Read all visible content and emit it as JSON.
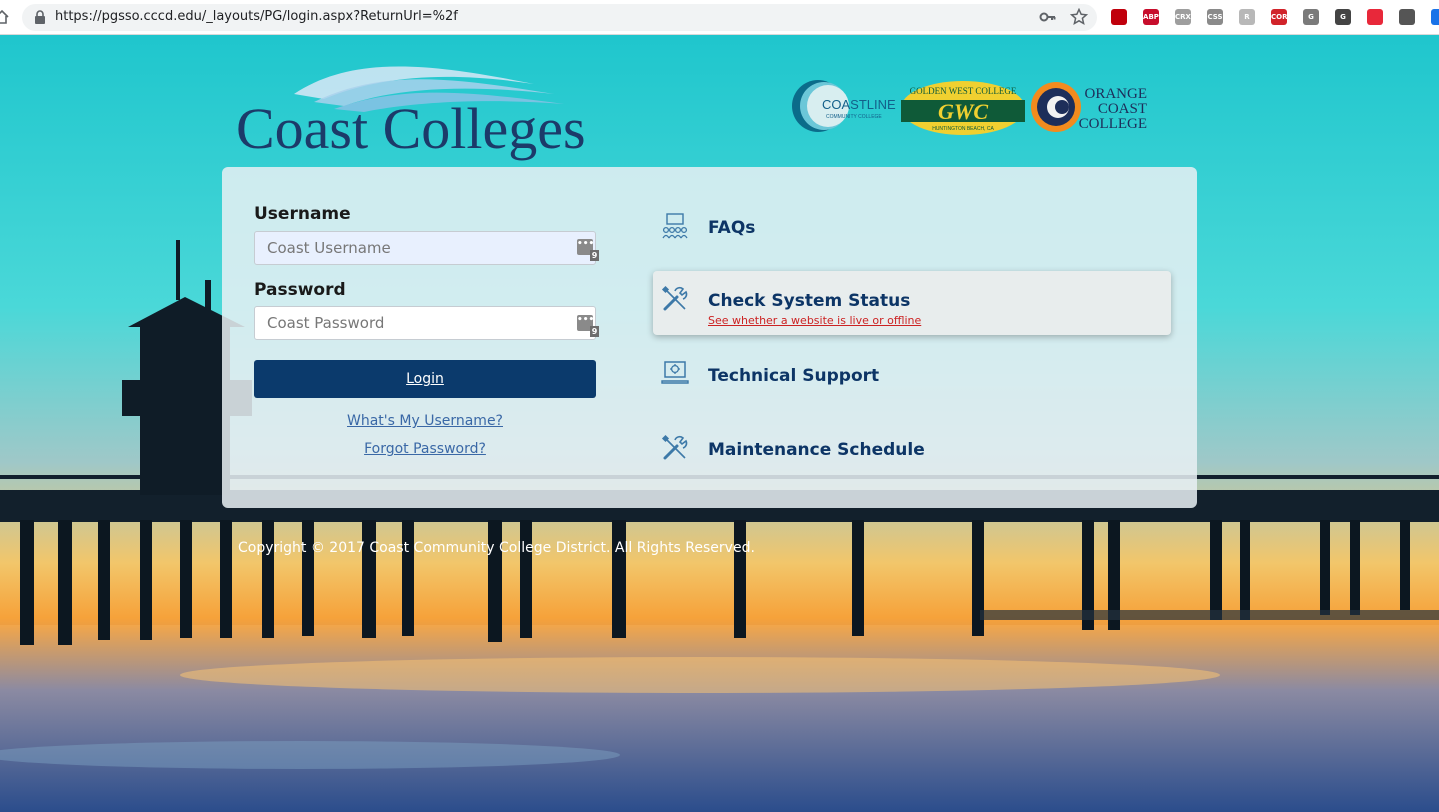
{
  "browser": {
    "url": "https://pgsso.cccd.edu/_layouts/PG/login.aspx?ReturnUrl=%2f",
    "extensions": [
      {
        "name": "ublock",
        "label": "",
        "color": "#c0000c"
      },
      {
        "name": "adblock-plus",
        "label": "ABP",
        "color": "#c70d2c"
      },
      {
        "name": "crx",
        "label": "CRX",
        "color": "#9e9e9e"
      },
      {
        "name": "css",
        "label": "CSS",
        "color": "#8a8a8a"
      },
      {
        "name": "r",
        "label": "R",
        "color": "#b8b8b8"
      },
      {
        "name": "cors",
        "label": "CORS",
        "color": "#d1232a"
      },
      {
        "name": "g-ext",
        "label": "G",
        "color": "#7a7a7a"
      },
      {
        "name": "grammarly",
        "label": "G",
        "color": "#444444"
      },
      {
        "name": "stack",
        "label": "",
        "color": "#e8283a"
      },
      {
        "name": "face",
        "label": "",
        "color": "#555555"
      },
      {
        "name": "blue-ext",
        "label": "",
        "color": "#1a73e8"
      }
    ]
  },
  "brand": {
    "main_logo": "Coast Colleges",
    "partner_logos": [
      "COASTLINE",
      "COMMUNITY COLLEGE",
      "GOLDEN WEST COLLEGE",
      "GWC",
      "HUNTINGTON BEACH, CA",
      "ORANGE",
      "COAST",
      "COLLEGE"
    ]
  },
  "login": {
    "username_label": "Username",
    "username_placeholder": "Coast Username",
    "password_label": "Password",
    "password_placeholder": "Coast Password",
    "manager_icon_text": "•••",
    "manager_badge": "9",
    "login_button": "Login",
    "forgot_username": "What's My Username?",
    "forgot_password": "Forgot Password?"
  },
  "menu": [
    {
      "title": "FAQs",
      "subtitle": "",
      "icon": "people-screen-icon"
    },
    {
      "title": "Check System Status",
      "subtitle": "See whether a website is live or offline",
      "icon": "tools-icon"
    },
    {
      "title": "Technical Support",
      "subtitle": "",
      "icon": "laptop-support-icon"
    },
    {
      "title": "Maintenance Schedule",
      "subtitle": "",
      "icon": "tools-icon"
    }
  ],
  "footer": {
    "copyright": "Copyright © 2017 Coast Community College District. All Rights Reserved."
  },
  "colors": {
    "primary": "#0b3a6c",
    "link": "#3a68a6",
    "alert": "#cc2222",
    "sky": "#2ad0d4"
  }
}
